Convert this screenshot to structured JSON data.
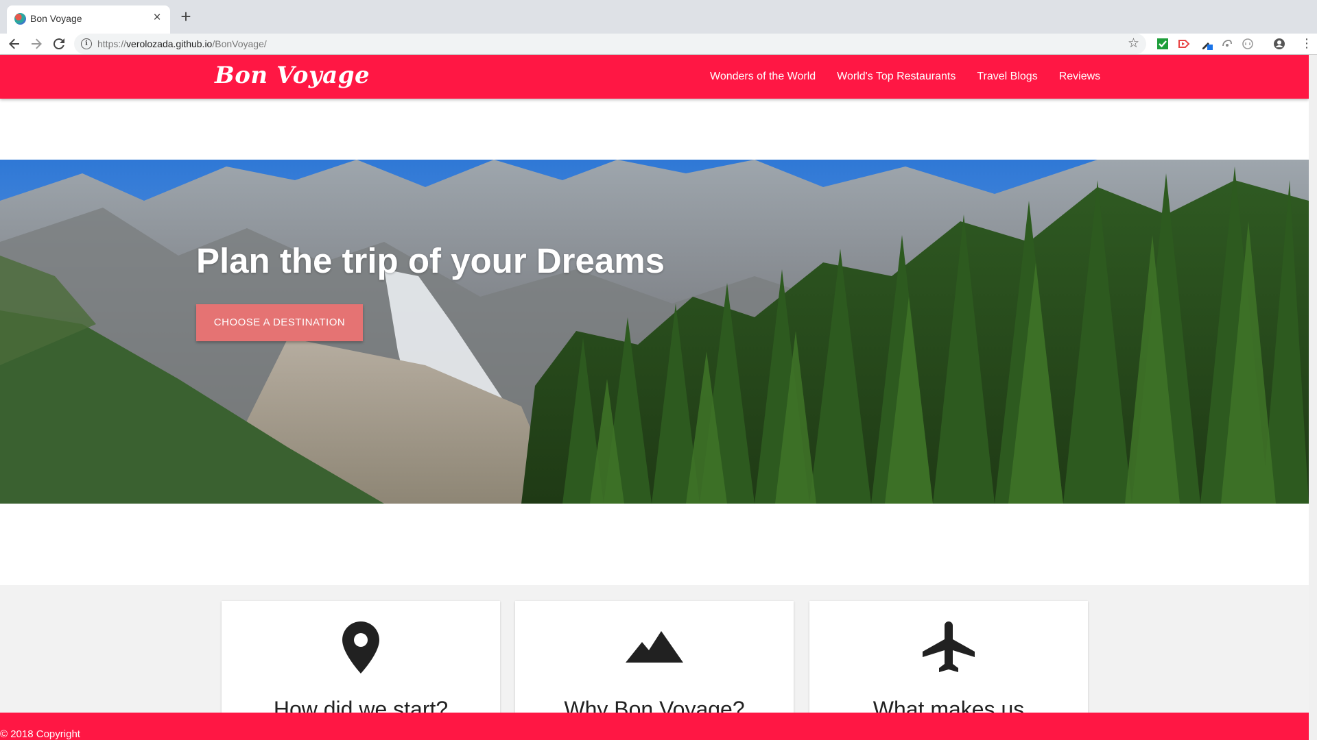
{
  "browser": {
    "tab_title": "Bon Voyage",
    "tab_close": "×",
    "new_tab": "+",
    "url_scheme": "https://",
    "url_host": "verolozada.github.io",
    "url_path": "/BonVoyage/"
  },
  "site": {
    "logo": "Bon Voyage",
    "nav": [
      "Wonders of the World",
      "World's Top Restaurants",
      "Travel Blogs",
      "Reviews"
    ],
    "brand_color": "#ff1744"
  },
  "hero": {
    "title": "Plan the trip of your Dreams",
    "button": "CHOOSE A DESTINATION",
    "button_color": "#e57373"
  },
  "cards": [
    {
      "icon": "map-pin-icon",
      "title": "How did we start?"
    },
    {
      "icon": "mountains-icon",
      "title": "Why Bon Voyage?"
    },
    {
      "icon": "airplane-icon",
      "title": "What makes us"
    }
  ],
  "footer": {
    "copyright": "© 2018 Copyright"
  }
}
